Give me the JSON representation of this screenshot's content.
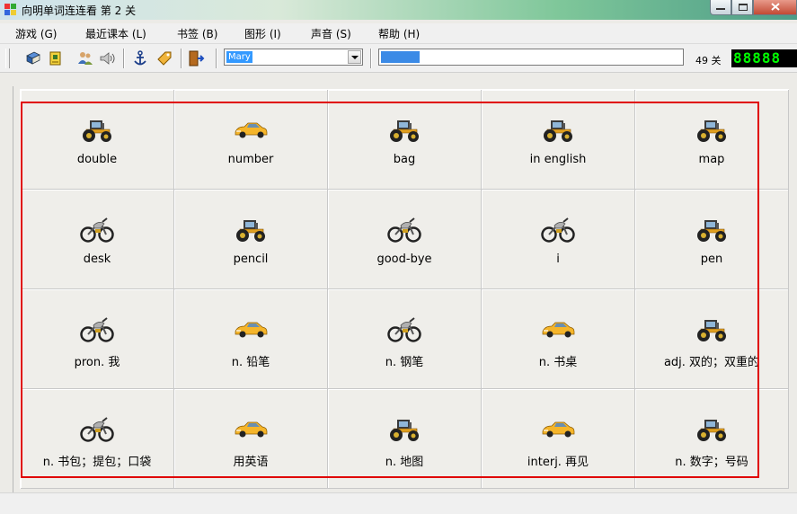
{
  "window": {
    "title": "向明单词连连看  第 2 关"
  },
  "menu": [
    {
      "label": "游戏 (G)"
    },
    {
      "label": "最近课本 (L)"
    },
    {
      "label": "书签 (B)"
    },
    {
      "label": "图形 (I)"
    },
    {
      "label": "声音 (S)"
    },
    {
      "label": "帮助 (H)"
    }
  ],
  "toolbar": {
    "buttons": [
      "book-icon",
      "card-icon",
      "people-icon",
      "speaker-icon",
      "anchor-icon",
      "tag-icon",
      "exit-door-icon"
    ],
    "name_select": {
      "value": "Mary"
    },
    "progress": {
      "fraction": 0.13
    },
    "level_label": "49 关",
    "timer": "88888"
  },
  "board": {
    "rows": [
      [
        {
          "icon": "tractor-icon",
          "word": "double"
        },
        {
          "icon": "car-icon",
          "word": "number"
        },
        {
          "icon": "tractor-icon",
          "word": "bag"
        },
        {
          "icon": "tractor-icon",
          "word": "in english"
        },
        {
          "icon": "tractor-icon",
          "word": "map"
        }
      ],
      [
        {
          "icon": "motorcycle-icon",
          "word": "desk"
        },
        {
          "icon": "tractor-icon",
          "word": "pencil"
        },
        {
          "icon": "motorcycle-icon",
          "word": "good-bye"
        },
        {
          "icon": "motorcycle-icon",
          "word": "i"
        },
        {
          "icon": "tractor-icon",
          "word": "pen"
        }
      ],
      [
        {
          "icon": "motorcycle-icon",
          "word": "pron. 我"
        },
        {
          "icon": "car-icon",
          "word": "n. 铅笔"
        },
        {
          "icon": "motorcycle-icon",
          "word": "n. 钢笔"
        },
        {
          "icon": "car-icon",
          "word": "n. 书桌"
        },
        {
          "icon": "tractor-icon",
          "word": "adj. 双的；双重的"
        }
      ],
      [
        {
          "icon": "motorcycle-icon",
          "word": "n. 书包；提包；口袋"
        },
        {
          "icon": "car-icon",
          "word": "用英语"
        },
        {
          "icon": "tractor-icon",
          "word": "n. 地图"
        },
        {
          "icon": "car-icon",
          "word": "interj. 再见"
        },
        {
          "icon": "tractor-icon",
          "word": "n. 数字；号码"
        }
      ]
    ]
  },
  "colors": {
    "selection": "#e00000",
    "progress": "#3b8ae6",
    "timer": "#00ff00"
  }
}
